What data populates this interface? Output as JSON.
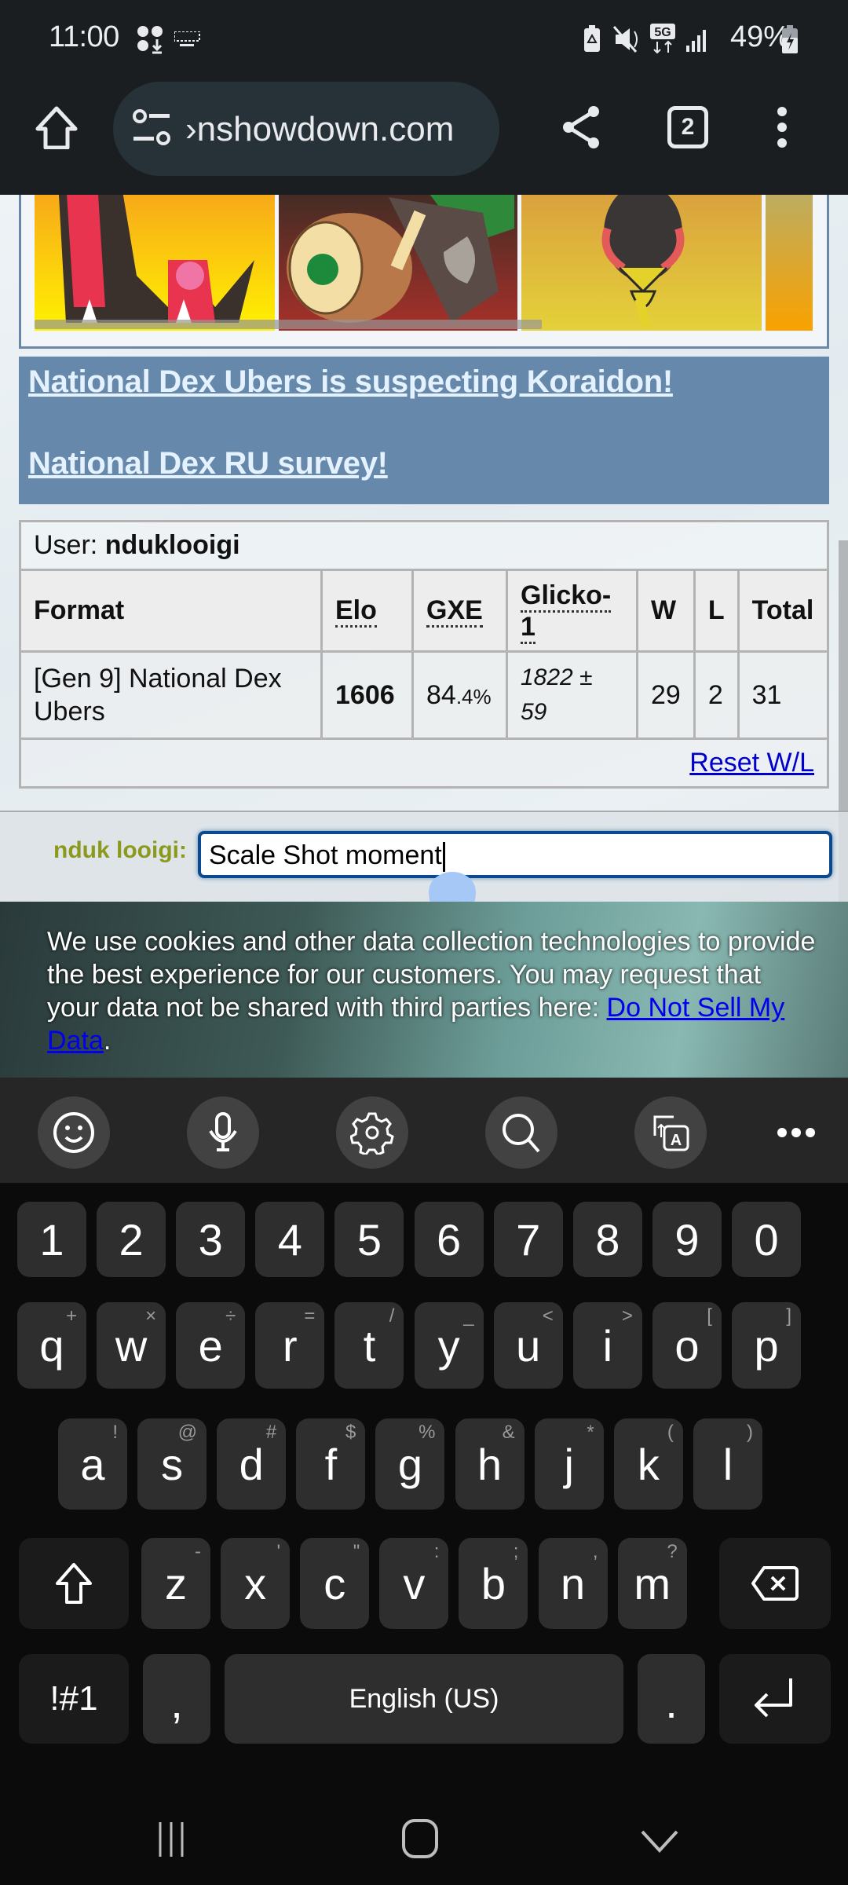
{
  "status_bar": {
    "time": "11:00",
    "battery_percent": "49%",
    "network": "5G",
    "icons": [
      "notification-dots-icon",
      "keyboard-icon",
      "battery-saver-icon",
      "mute-vibrate-icon",
      "5g-data-icon",
      "signal-icon",
      "battery-charging-icon"
    ]
  },
  "browser": {
    "url": "pokemonshowdown.com",
    "url_visible": "›nshowdown.com",
    "tab_count": "2",
    "home_label": "Home",
    "share_label": "Share",
    "menu_label": "More options"
  },
  "page": {
    "sprites": [
      "Primal Groudon",
      "Rillaboom",
      "Kilowattrel"
    ],
    "announcements": [
      {
        "text": "National Dex Ubers is suspecting Koraidon!"
      },
      {
        "text": "National Dex RU survey!"
      }
    ],
    "ladder": {
      "user_label": "User:",
      "username": "nduklooigi",
      "columns": [
        "Format",
        "Elo",
        "GXE",
        "Glicko-1",
        "W",
        "L",
        "Total"
      ],
      "rows": [
        {
          "format": "[Gen 9] National Dex Ubers",
          "elo": "1606",
          "gxe_main": "84",
          "gxe_decimal": ".4%",
          "glicko": "1822 ± 59",
          "w": "29",
          "l": "2",
          "total": "31"
        }
      ],
      "reset_label": "Reset W/L"
    },
    "chat": {
      "name": "nduk looigi:",
      "name_color": "#8c9a1c",
      "input_value": "Scale Shot moment"
    },
    "cookie_banner": {
      "text": "We use cookies and other data collection technologies to provide the best experience for our customers. You may request that your data not be shared with third parties here: ",
      "link": "Do Not Sell My Data",
      "suffix": "."
    }
  },
  "keyboard": {
    "toolbar": [
      "emoji-icon",
      "mic-icon",
      "settings-icon",
      "search-icon",
      "translate-icon",
      "more-icon"
    ],
    "number_row": [
      "1",
      "2",
      "3",
      "4",
      "5",
      "6",
      "7",
      "8",
      "9",
      "0"
    ],
    "row1": [
      {
        "k": "q",
        "h": "+"
      },
      {
        "k": "w",
        "h": "×"
      },
      {
        "k": "e",
        "h": "÷"
      },
      {
        "k": "r",
        "h": "="
      },
      {
        "k": "t",
        "h": "/"
      },
      {
        "k": "y",
        "h": "_"
      },
      {
        "k": "u",
        "h": "<"
      },
      {
        "k": "i",
        "h": ">"
      },
      {
        "k": "o",
        "h": "["
      },
      {
        "k": "p",
        "h": "]"
      }
    ],
    "row2": [
      {
        "k": "a",
        "h": "!"
      },
      {
        "k": "s",
        "h": "@"
      },
      {
        "k": "d",
        "h": "#"
      },
      {
        "k": "f",
        "h": "$"
      },
      {
        "k": "g",
        "h": "%"
      },
      {
        "k": "h",
        "h": "&"
      },
      {
        "k": "j",
        "h": "*"
      },
      {
        "k": "k",
        "h": "("
      },
      {
        "k": "l",
        "h": ")"
      }
    ],
    "row3": [
      {
        "k": "z",
        "h": "-"
      },
      {
        "k": "x",
        "h": "'"
      },
      {
        "k": "c",
        "h": "\""
      },
      {
        "k": "v",
        "h": ":"
      },
      {
        "k": "b",
        "h": ";"
      },
      {
        "k": "n",
        "h": ","
      },
      {
        "k": "m",
        "h": "?"
      }
    ],
    "symbols_label": "!#1",
    "comma": ",",
    "space_label": "English (US)",
    "period": "."
  },
  "nav": {
    "recents": "Recent apps",
    "home": "Home",
    "back": "Hide keyboard"
  }
}
